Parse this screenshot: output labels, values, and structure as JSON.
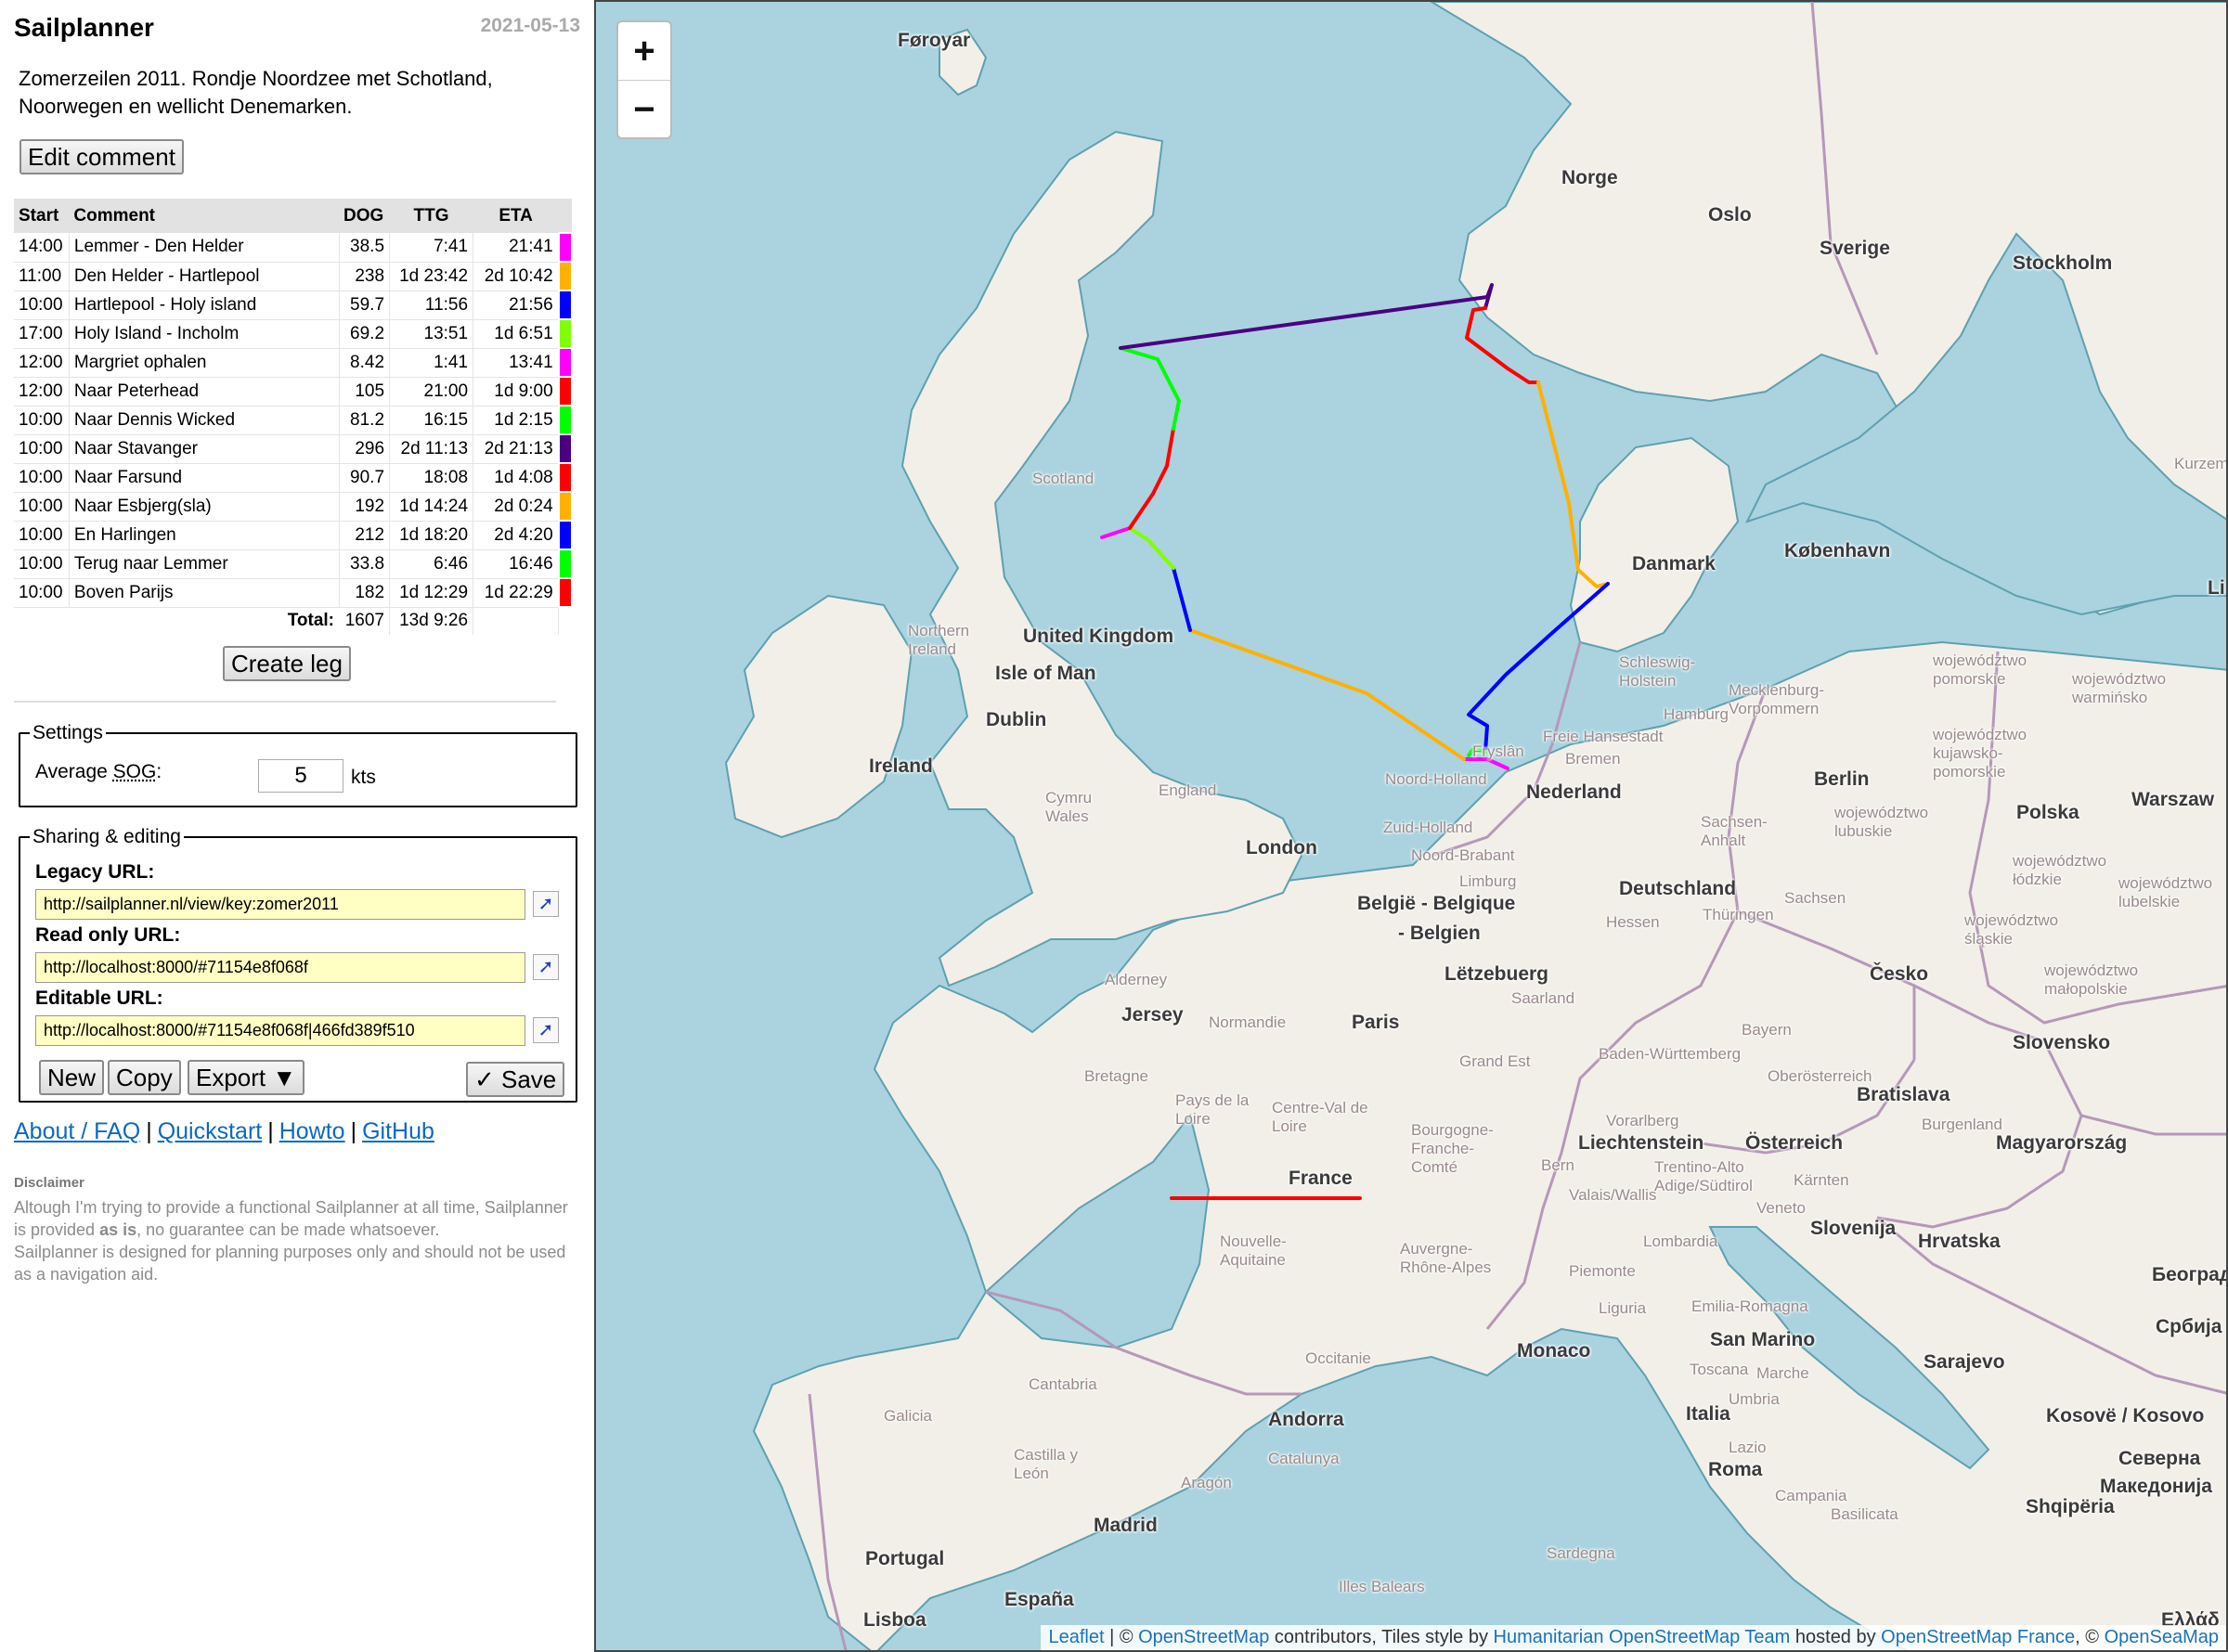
{
  "app": {
    "title": "Sailplanner",
    "date": "2021-05-13"
  },
  "comment": "Zomerzeilen 2011. Rondje Noordzee met Schotland, Noorwegen en wellicht Denemarken.",
  "buttons": {
    "edit_comment": "Edit comment",
    "create_leg": "Create leg",
    "new": "New",
    "copy": "Copy",
    "export": "Export ▼",
    "save": "✓ Save"
  },
  "table": {
    "headers": [
      "Start",
      "Comment",
      "DOG",
      "TTG",
      "ETA"
    ],
    "rows": [
      {
        "start": "14:00",
        "comment": "Lemmer - Den Helder",
        "dog": "38.5",
        "ttg": "7:41",
        "eta": "21:41",
        "color": "#ff00ff"
      },
      {
        "start": "11:00",
        "comment": "Den Helder - Hartlepool",
        "dog": "238",
        "ttg": "1d 23:42",
        "eta": "2d 10:42",
        "color": "#ffb000"
      },
      {
        "start": "10:00",
        "comment": "Hartlepool - Holy island",
        "dog": "59.7",
        "ttg": "11:56",
        "eta": "21:56",
        "color": "#0000ff"
      },
      {
        "start": "17:00",
        "comment": "Holy Island - Incholm",
        "dog": "69.2",
        "ttg": "13:51",
        "eta": "1d 6:51",
        "color": "#80ff00"
      },
      {
        "start": "12:00",
        "comment": "Margriet ophalen",
        "dog": "8.42",
        "ttg": "1:41",
        "eta": "13:41",
        "color": "#ff00ff"
      },
      {
        "start": "12:00",
        "comment": "Naar Peterhead",
        "dog": "105",
        "ttg": "21:00",
        "eta": "1d 9:00",
        "color": "#ff0000"
      },
      {
        "start": "10:00",
        "comment": "Naar Dennis Wicked",
        "dog": "81.2",
        "ttg": "16:15",
        "eta": "1d 2:15",
        "color": "#00ff00"
      },
      {
        "start": "10:00",
        "comment": "Naar Stavanger",
        "dog": "296",
        "ttg": "2d 11:13",
        "eta": "2d 21:13",
        "color": "#4b0082"
      },
      {
        "start": "10:00",
        "comment": "Naar Farsund",
        "dog": "90.7",
        "ttg": "18:08",
        "eta": "1d 4:08",
        "color": "#ff0000"
      },
      {
        "start": "10:00",
        "comment": "Naar Esbjerg(sla)",
        "dog": "192",
        "ttg": "1d 14:24",
        "eta": "2d 0:24",
        "color": "#ffb000"
      },
      {
        "start": "10:00",
        "comment": "En Harlingen",
        "dog": "212",
        "ttg": "1d 18:20",
        "eta": "2d 4:20",
        "color": "#0000ff"
      },
      {
        "start": "10:00",
        "comment": "Terug naar Lemmer",
        "dog": "33.8",
        "ttg": "6:46",
        "eta": "16:46",
        "color": "#00ff00"
      },
      {
        "start": "10:00",
        "comment": "Boven Parijs",
        "dog": "182",
        "ttg": "1d 12:29",
        "eta": "1d 22:29",
        "color": "#ff0000"
      }
    ],
    "total_label": "Total:",
    "total_dog": "1607",
    "total_ttg": "13d 9:26"
  },
  "settings": {
    "legend": "Settings",
    "label_prefix": "Average ",
    "label_abbr": "SOG",
    "label_suffix": ":",
    "sog": "5",
    "unit": "kts"
  },
  "sharing": {
    "legend": "Sharing & editing",
    "legacy_label": "Legacy URL:",
    "legacy_url": "http://sailplanner.nl/view/key:zomer2011",
    "readonly_label": "Read only URL:",
    "readonly_url": "http://localhost:8000/#71154e8f068f",
    "editable_label": "Editable URL:",
    "editable_url": "http://localhost:8000/#71154e8f068f|466fd389f510",
    "open_icon": "arrow-ne-icon"
  },
  "links": {
    "about": "About / FAQ",
    "quickstart": "Quickstart",
    "howto": "Howto",
    "github": "GitHub",
    "sep": "|"
  },
  "disclaimer": {
    "title": "Disclaimer",
    "line1_a": "Altough I'm trying to provide a functional Sailplanner at all time, Sailplanner is provided ",
    "line1_b": "as is",
    "line1_c": ", no guarantee can be made whatsoever.",
    "line2": "Sailplanner is designed for planning purposes only and should not be used as a navigation aid."
  },
  "map": {
    "zoom_in": "+",
    "zoom_out": "−",
    "labels": {
      "faroe": "Føroyar",
      "norge": "Norge",
      "oslo": "Oslo",
      "sverige": "Sverige",
      "stockholm": "Stockholm",
      "danmark": "Danmark",
      "kobenhavn": "København",
      "uk": "United Kingdom",
      "isle_of_man": "Isle of Man",
      "dublin": "Dublin",
      "ireland": "Ireland",
      "nederland": "Nederland",
      "berlin": "Berlin",
      "london": "London",
      "belgie": "België - Belgique",
      "belgien": "- Belgien",
      "deutschland": "Deutschland",
      "polska": "Polska",
      "warszawa": "Warszaw",
      "letzebuerg": "Lëtzebuerg",
      "cesko": "Česko",
      "jersey": "Jersey",
      "paris": "Paris",
      "slovensko": "Slovensko",
      "bratislava": "Bratislava",
      "liechtenstein": "Liechtenstein",
      "osterreich": "Österreich",
      "magyarorszag": "Magyarország",
      "france": "France",
      "slovenija": "Slovenija",
      "hrvatska": "Hrvatska",
      "beograd": "Београд",
      "srbija": "Србија",
      "monaco": "Monaco",
      "san_marino": "San Marino",
      "sarajevo": "Sarajevo",
      "andorra": "Andorra",
      "italia": "Italia",
      "kosove": "Kosovë / Kosovo",
      "severna": "Северна",
      "makedonija": "Македонија",
      "shqiperia": "Shqipëria",
      "roma": "Roma",
      "madrid": "Madrid",
      "portugal": "Portugal",
      "espana": "España",
      "lisboa": "Lisboa",
      "ellada": "Ελλάδ",
      "li": "Li",
      "scotland": "Scotland",
      "northern_ireland": "Northern Ireland",
      "cymru": "Cymru Wales",
      "england": "England",
      "schleswig": "Schleswig-Holstein",
      "hamburg": "Hamburg",
      "mecklenburg": "Mecklenburg-Vorpommern",
      "bremen": "Bremen",
      "sachsen": "Sachsen-Anhalt",
      "thuringen": "Thüringen",
      "sachsen2": "Sachsen",
      "hessen": "Hessen",
      "bayern": "Bayern",
      "baden": "Baden-Württemberg",
      "oberosterreich": "Oberösterreich",
      "burgenland": "Burgenland",
      "grand_est": "Grand Est",
      "normandie": "Normandie",
      "bretagne": "Bretagne",
      "pays_loire": "Pays de la Loire",
      "centre": "Centre-Val de Loire",
      "bourgogne": "Bourgogne-Franche-Comté",
      "nouvelle": "Nouvelle-Aquitaine",
      "auvergne": "Auvergne-Rhône-Alpes",
      "occitanie": "Occitanie",
      "cantabria": "Cantabria",
      "galicia": "Galicia",
      "castilla": "Castilla y León",
      "aragon": "Aragón",
      "catalunya": "Catalunya",
      "illes": "Illes Balears",
      "sardegna": "Sardegna",
      "toscana": "Toscana",
      "marche": "Marche",
      "umbria": "Umbria",
      "lazio": "Lazio",
      "campania": "Campania",
      "basilicata": "Basilicata",
      "lombardia": "Lombardia",
      "emilia": "Emilia-Romagna",
      "piemonte": "Piemonte",
      "liguria": "Liguria",
      "alderney": "Alderney",
      "noord_holland": "Noord-Holland",
      "zuid_holland": "Zuid-Holland",
      "noord_brabant": "Noord-Brabant",
      "limburg": "Limburg",
      "friesland": "Fryslân",
      "kurzeme": "Kurzeme",
      "pomorskie": "województwo pomorskie",
      "warminsko": "województwo warmińsko",
      "lubuskie": "województwo lubuskie",
      "lodzkie": "województwo łódzkie",
      "slaskie": "województwo śląskie",
      "malopolskie": "województwo małopolskie",
      "lubelskie": "województwo lubelskie",
      "kujawsko": "województwo kujawsko-pomorskie",
      "freie": "Freie Hansestadt",
      "saarland": "Saarland",
      "tirol": "Trentino-Alto Adige/Südtirol",
      "valais": "Valais/Wallis",
      "bern": "Bern",
      "karnten": "Kärnten",
      "veneto": "Veneto",
      "vorarlberg": "Vorarlberg"
    },
    "attribution": {
      "leaflet": "Leaflet",
      "sep": " | © ",
      "osm": "OpenStreetMap",
      "contrib": " contributors, Tiles style by ",
      "hot": "Humanitarian OpenStreetMap Team",
      "hosted": " hosted by ",
      "osmfr": "OpenStreetMap France",
      "c2": ", © ",
      "seamap": "OpenSeaMap"
    }
  }
}
